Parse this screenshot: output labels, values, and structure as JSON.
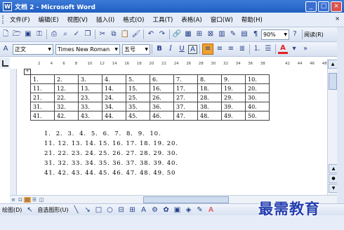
{
  "window": {
    "title": "文档 2 - Microsoft Word",
    "app_icon_letter": "W",
    "buttons": [
      "_",
      "□",
      "×"
    ]
  },
  "menu": {
    "items": [
      "文件(F)",
      "编辑(E)",
      "视图(V)",
      "插入(I)",
      "格式(O)",
      "工具(T)",
      "表格(A)",
      "窗口(W)",
      "帮助(H)"
    ],
    "help_close": "×"
  },
  "toolbar_standard": {
    "zoom": "90%",
    "reading_mode": "阅读(R)"
  },
  "toolbar_formatting": {
    "style": "正文",
    "font": "Times New Roman",
    "size": "五号",
    "bold": "B",
    "italic": "I",
    "underline": "U",
    "char_border": "A",
    "font_color_letter": "A"
  },
  "ruler": {
    "ticks": [
      "2",
      "4",
      "6",
      "8",
      "10",
      "12",
      "14",
      "16",
      "18",
      "20",
      "22",
      "24",
      "26",
      "28",
      "30",
      "32",
      "34",
      "36",
      "38",
      "",
      "42",
      "44",
      "46",
      "48"
    ]
  },
  "table": {
    "rows": [
      [
        "1.",
        "2.",
        "3.",
        "4.",
        "5.",
        "6.",
        "7.",
        "8.",
        "9.",
        "10."
      ],
      [
        "11.",
        "12.",
        "13.",
        "14.",
        "15.",
        "16.",
        "17.",
        "18.",
        "19.",
        "20."
      ],
      [
        "21.",
        "22.",
        "23.",
        "24.",
        "25.",
        "26.",
        "27.",
        "28.",
        "29.",
        "30."
      ],
      [
        "31.",
        "32.",
        "33.",
        "34.",
        "35.",
        "36.",
        "37.",
        "38.",
        "39.",
        "40."
      ],
      [
        "41.",
        "42.",
        "43.",
        "44.",
        "45.",
        "46.",
        "47.",
        "48.",
        "49.",
        "50."
      ]
    ]
  },
  "text_lines": [
    "1.  2.  3.  4.  5.  6.  7.  8.  9.  10.",
    "11. 12. 13. 14. 15. 16. 17. 18. 19. 20.",
    "21. 22. 23. 24. 25. 26. 27. 28. 29. 30.",
    "31. 32. 33. 34. 35. 36. 37. 38. 39. 40.",
    "41. 42. 43. 44. 45. 46. 47. 48. 49. 50"
  ],
  "drawing_toolbar": {
    "draw_label": "绘图(D)",
    "autoshapes_label": "自选图形(U)"
  },
  "watermark": "最需教育",
  "colors": {
    "title_bar": "#1f5ec2",
    "accent_highlight": "#f0a030",
    "font_color_red": "#e02020",
    "watermark": "#253fb0"
  }
}
